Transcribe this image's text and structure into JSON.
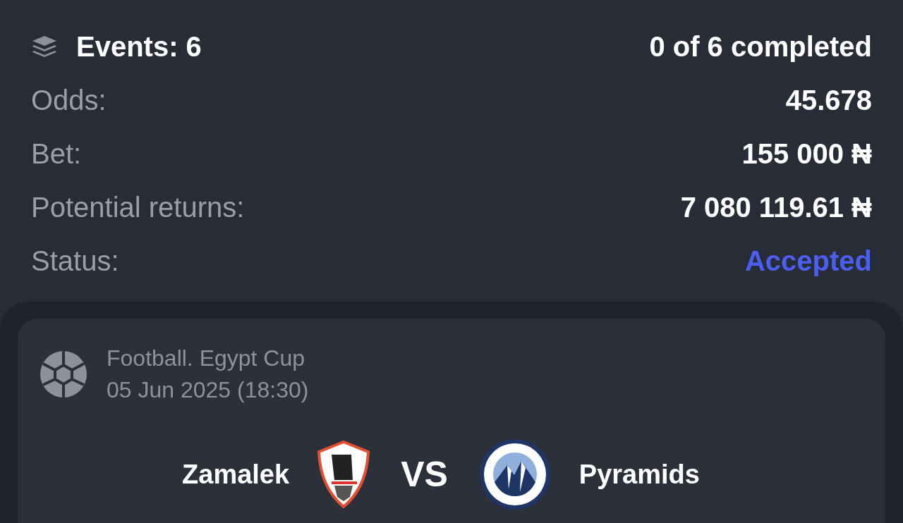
{
  "summary": {
    "events_label": "Events: 6",
    "completed": "0 of 6 completed"
  },
  "rows": [
    {
      "label": "Odds:",
      "value": "45.678",
      "kind": "plain"
    },
    {
      "label": "Bet:",
      "value": "155 000 ₦",
      "kind": "plain"
    },
    {
      "label": "Potential returns:",
      "value": "7 080 119.61 ₦",
      "kind": "plain"
    },
    {
      "label": "Status:",
      "value": "Accepted",
      "kind": "status"
    }
  ],
  "event": {
    "title": "Football. Egypt Cup",
    "date": "05 Jun 2025 (18:30)",
    "home": "Zamalek",
    "vs": "VS",
    "away": "Pyramids"
  }
}
